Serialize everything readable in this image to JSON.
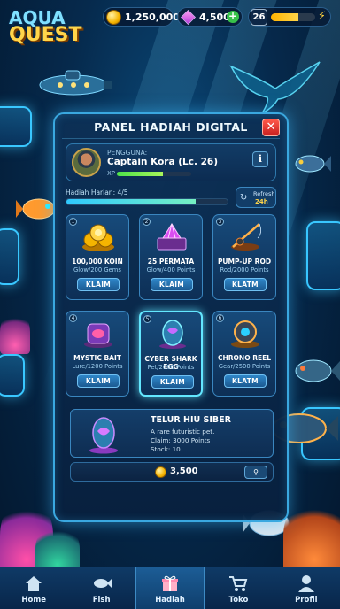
{
  "game": {
    "logo_line1": "AQUA",
    "logo_line2": "QUEST"
  },
  "topbar": {
    "coins": "1,250,000",
    "gems": "4,500",
    "level": "26",
    "xp_fraction": 0.62
  },
  "panel": {
    "title": "PANEL HADIAH DIGITAL",
    "close_label": "✕",
    "user": {
      "label": "PENGGUNA:",
      "name": "Captain Kora (Lc. 26)",
      "xp_label": "XP",
      "xp_fraction": 0.62,
      "info_label": "i"
    },
    "daily": {
      "label": "Hadiah Harian: 4/5",
      "fraction": 0.8,
      "refresh_label": "Refresh",
      "refresh_time": "24h"
    },
    "rewards": [
      {
        "num": "1",
        "name": "100,000 KOIN",
        "sub": "Glow/200 Gems",
        "button": "KLAIM",
        "icon": "coin-pile-icon"
      },
      {
        "num": "2",
        "name": "25 PERMATA",
        "sub": "Glow/400 Points",
        "button": "KLAIM",
        "icon": "gem-chest-icon"
      },
      {
        "num": "3",
        "name": "PUMP-UP ROD",
        "sub": "Rod/2000 Points",
        "button": "KLATM",
        "icon": "fishing-rod-icon"
      },
      {
        "num": "4",
        "name": "MYSTIC BAIT",
        "sub": "Lure/1200 Points",
        "button": "KLAIM",
        "icon": "mystic-bait-icon"
      },
      {
        "num": "5",
        "name": "CYBER SHARK EGG",
        "sub": "Pet/2000 Points",
        "button": "KLAIM",
        "icon": "shark-egg-icon"
      },
      {
        "num": "6",
        "name": "CHRONO REEL",
        "sub": "Gear/2500 Points",
        "button": "KLATM",
        "icon": "chrono-reel-icon"
      }
    ],
    "detail": {
      "title": "TELUR HIU SIBER",
      "line1": "A rare futuristic pet.",
      "line2": "Claim: 3000 Points",
      "line3": "Stock: 10"
    },
    "price": {
      "value": "3,500",
      "button_label": "⚲"
    }
  },
  "nav": [
    {
      "label": "Home",
      "icon": "home-icon"
    },
    {
      "label": "Fish",
      "icon": "fish-icon"
    },
    {
      "label": "Hadiah",
      "icon": "gift-icon",
      "active": true
    },
    {
      "label": "Toko",
      "icon": "cart-icon"
    },
    {
      "label": "Profil",
      "icon": "profile-icon"
    }
  ],
  "colors": {
    "accent": "#3aa8e0",
    "gold": "#ffd54a",
    "close": "#d92a2a",
    "xp": "#4de34a"
  }
}
